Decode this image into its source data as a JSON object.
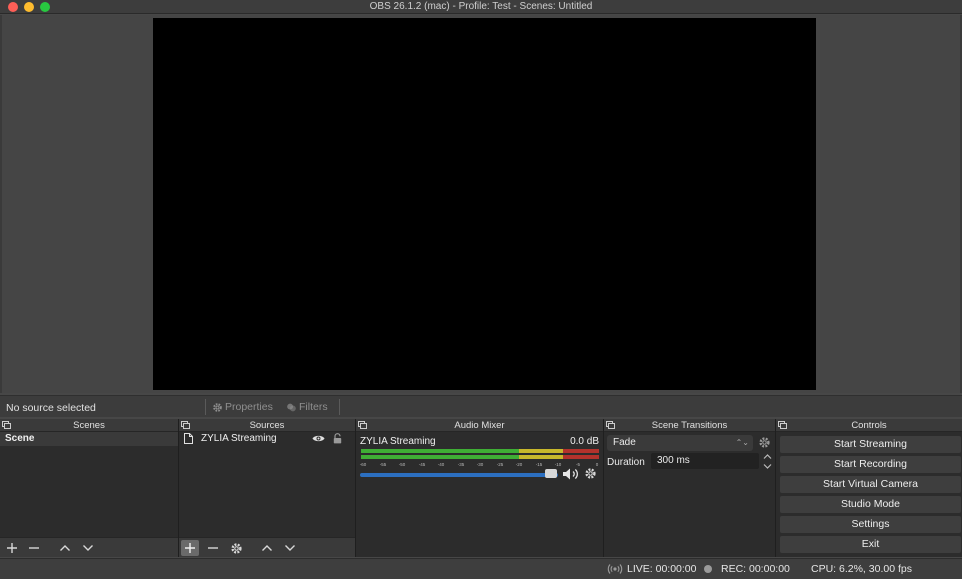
{
  "window": {
    "title": "OBS 26.1.2 (mac) - Profile: Test - Scenes: Untitled"
  },
  "context_bar": {
    "selection_label": "No source selected",
    "properties_label": "Properties",
    "filters_label": "Filters"
  },
  "docks": {
    "scenes": {
      "title": "Scenes",
      "items": [
        {
          "label": "Scene",
          "selected": true
        }
      ]
    },
    "sources": {
      "title": "Sources",
      "items": [
        {
          "label": "ZYLIA Streaming",
          "visible": true,
          "locked": false
        }
      ]
    },
    "audio_mixer": {
      "title": "Audio Mixer",
      "channel_name": "ZYLIA Streaming",
      "channel_level": "0.0 dB",
      "meter_ticks": [
        "-60",
        "-55",
        "-50",
        "-45",
        "-40",
        "-35",
        "-30",
        "-25",
        "-20",
        "-15",
        "-10",
        "-5",
        "0"
      ],
      "volume_fraction": 1.0
    },
    "scene_transitions": {
      "title": "Scene Transitions",
      "transition": "Fade",
      "duration_label": "Duration",
      "duration_value": "300 ms"
    },
    "controls": {
      "title": "Controls",
      "start_streaming": "Start Streaming",
      "start_recording": "Start Recording",
      "start_virtual_camera": "Start Virtual Camera",
      "studio_mode": "Studio Mode",
      "settings": "Settings",
      "exit": "Exit"
    }
  },
  "status_bar": {
    "live": "LIVE: 00:00:00",
    "rec": "REC: 00:00:00",
    "cpu": "CPU: 6.2%, 30.00 fps"
  },
  "colors": {
    "meter_green": "#3fae35",
    "meter_yellow": "#c8b82c",
    "meter_red": "#b3322c",
    "volume_blue": "#2c6fc0",
    "preview_bg": "#000000"
  }
}
